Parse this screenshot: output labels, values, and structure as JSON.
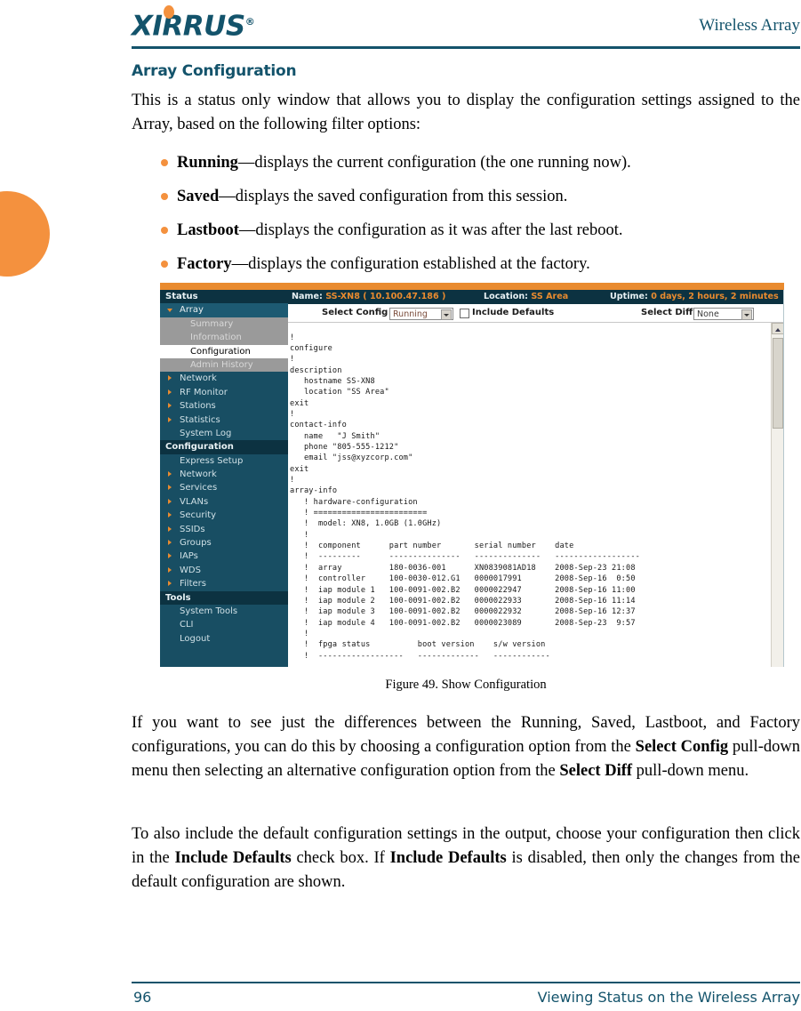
{
  "header": {
    "logo_text": "XIRRUS",
    "logo_registered": "®",
    "title": "Wireless Array"
  },
  "section": {
    "title": "Array Configuration",
    "intro": "This is a status only window that allows you to display the configuration settings assigned to the Array, based on the following filter options:",
    "bullets": [
      {
        "term": "Running",
        "desc": "—displays the current configuration (the one running now)."
      },
      {
        "term": "Saved",
        "desc": "—displays the saved configuration from this session."
      },
      {
        "term": "Lastboot",
        "desc": "—displays the configuration as it was after the last reboot."
      },
      {
        "term": "Factory",
        "desc": "—displays the configuration established at the factory."
      }
    ],
    "para2_a": "If you want to see just the differences between the Running, Saved, Lastboot, and Factory configurations, you can do this by choosing a configuration option from the ",
    "para2_b": "Select Config",
    "para2_c": " pull-down menu then selecting an alternative configuration option from the ",
    "para2_d": "Select Diff",
    "para2_e": " pull-down menu.",
    "para3_a": "To also include the default configuration settings in the output, choose your configuration then click in the ",
    "para3_b": "Include Defaults",
    "para3_c": " check box. If ",
    "para3_d": "Include Defaults",
    "para3_e": " is disabled, then only the changes from the default configuration are shown."
  },
  "figure": {
    "caption": "Figure 49. Show Configuration",
    "statusbar": {
      "name_label": "Name:",
      "name_value": "SS-XN8   ( 10.100.47.186 )",
      "location_label": "Location:",
      "location_value": "SS Area",
      "uptime_label": "Uptime:",
      "uptime_value": "0 days, 2 hours, 2 minutes"
    },
    "controls": {
      "select_config_label": "Select Config",
      "select_config_value": "Running",
      "include_defaults_label": "Include Defaults",
      "include_defaults_checked": false,
      "select_diff_label": "Select Diff",
      "select_diff_value": "None"
    },
    "sidebar": [
      {
        "label": "Status",
        "type": "group"
      },
      {
        "label": "Array",
        "type": "expanded",
        "arrow": "down"
      },
      {
        "label": "Summary",
        "type": "sub"
      },
      {
        "label": "Information",
        "type": "sub"
      },
      {
        "label": "Configuration",
        "type": "sub-selected"
      },
      {
        "label": "Admin History",
        "type": "sub"
      },
      {
        "label": "Network",
        "type": "item",
        "arrow": "right"
      },
      {
        "label": "RF Monitor",
        "type": "item",
        "arrow": "right"
      },
      {
        "label": "Stations",
        "type": "item",
        "arrow": "right"
      },
      {
        "label": "Statistics",
        "type": "item",
        "arrow": "right"
      },
      {
        "label": "System Log",
        "type": "item"
      },
      {
        "label": "Configuration",
        "type": "group"
      },
      {
        "label": "Express Setup",
        "type": "item"
      },
      {
        "label": "Network",
        "type": "item",
        "arrow": "right"
      },
      {
        "label": "Services",
        "type": "item",
        "arrow": "right"
      },
      {
        "label": "VLANs",
        "type": "item",
        "arrow": "right"
      },
      {
        "label": "Security",
        "type": "item",
        "arrow": "right"
      },
      {
        "label": "SSIDs",
        "type": "item",
        "arrow": "right"
      },
      {
        "label": "Groups",
        "type": "item",
        "arrow": "right"
      },
      {
        "label": "IAPs",
        "type": "item",
        "arrow": "right"
      },
      {
        "label": "WDS",
        "type": "item",
        "arrow": "right"
      },
      {
        "label": "Filters",
        "type": "item",
        "arrow": "right"
      },
      {
        "label": "Tools",
        "type": "group"
      },
      {
        "label": "System Tools",
        "type": "item"
      },
      {
        "label": "CLI",
        "type": "item"
      },
      {
        "label": "Logout",
        "type": "item"
      }
    ],
    "config_output": "!\nconfigure\n!\ndescription\n   hostname SS-XN8\n   location \"SS Area\"\nexit\n!\ncontact-info\n   name   \"J Smith\"\n   phone \"805-555-1212\"\n   email \"jss@xyzcorp.com\"\nexit\n!\narray-info\n   ! hardware-configuration\n   ! ========================\n   !  model: XN8, 1.0GB (1.0GHz)\n   !\n   !  component      part number       serial number    date\n   !  ---------      ---------------   --------------   ------------------\n   !  array          180-0036-001      XN0839081AD18    2008-Sep-23 21:08\n   !  controller     100-0030-012.G1   0000017991       2008-Sep-16  0:50\n   !  iap module 1   100-0091-002.B2   0000022947       2008-Sep-16 11:00\n   !  iap module 2   100-0091-002.B2   0000022933       2008-Sep-16 11:14\n   !  iap module 3   100-0091-002.B2   0000022932       2008-Sep-16 12:37\n   !  iap module 4   100-0091-002.B2   0000023089       2008-Sep-23  9:57\n   !\n   !  fpga status          boot version    s/w version\n   !  ------------------   -------------   ------------"
  },
  "footer": {
    "page_number": "96",
    "running_title": "Viewing Status on the Wireless Array"
  },
  "colors": {
    "brand_teal": "#13536b",
    "brand_orange": "#f4913e",
    "nav_dark": "#184e63",
    "nav_group": "#0c3241"
  }
}
